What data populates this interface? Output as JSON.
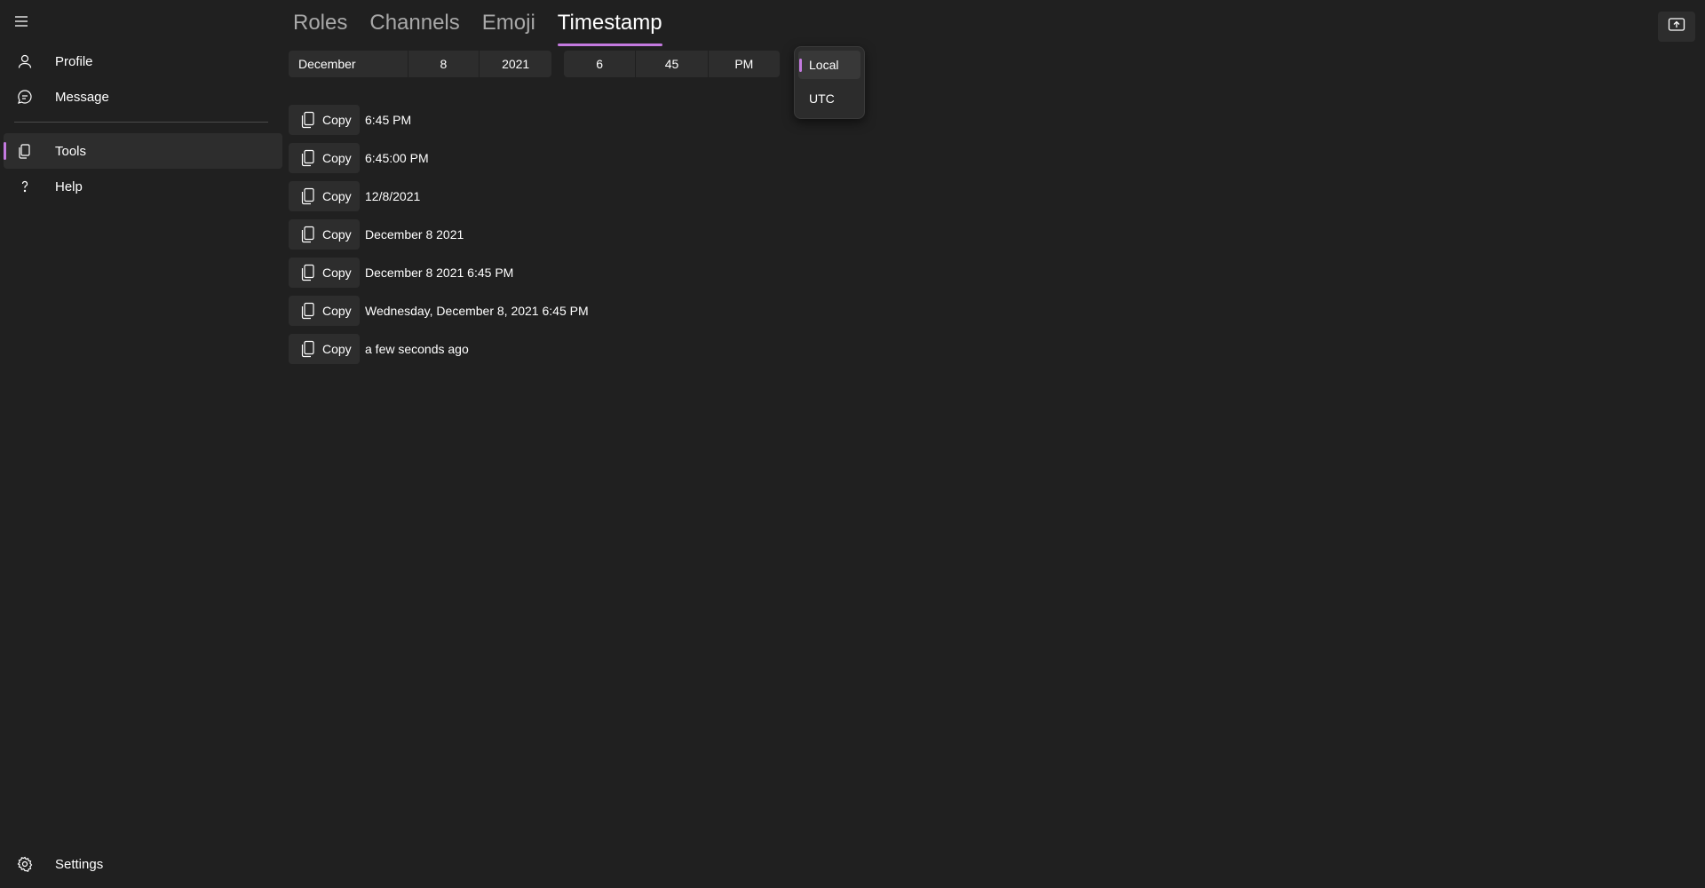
{
  "sidebar": {
    "items": [
      {
        "label": "Profile",
        "icon": "person-icon"
      },
      {
        "label": "Message",
        "icon": "chat-icon"
      },
      {
        "label": "Tools",
        "icon": "copy-icon"
      },
      {
        "label": "Help",
        "icon": "question-icon"
      }
    ],
    "settings_label": "Settings"
  },
  "tabs": [
    {
      "label": "Roles"
    },
    {
      "label": "Channels"
    },
    {
      "label": "Emoji"
    },
    {
      "label": "Timestamp"
    }
  ],
  "date_picker": {
    "month": "December",
    "day": "8",
    "year": "2021"
  },
  "time_picker": {
    "hour": "6",
    "minute": "45",
    "period": "PM"
  },
  "timezone_menu": {
    "options": [
      "Local",
      "UTC"
    ],
    "selected": "Local"
  },
  "copy_label": "Copy",
  "formats": [
    "6:45 PM",
    "6:45:00 PM",
    "12/8/2021",
    "December 8 2021",
    "December 8 2021 6:45 PM",
    "Wednesday, December 8, 2021 6:45 PM",
    "a few seconds ago"
  ],
  "colors": {
    "accent": "#c47ae0",
    "background": "#202020",
    "control": "#2d2d2d"
  }
}
